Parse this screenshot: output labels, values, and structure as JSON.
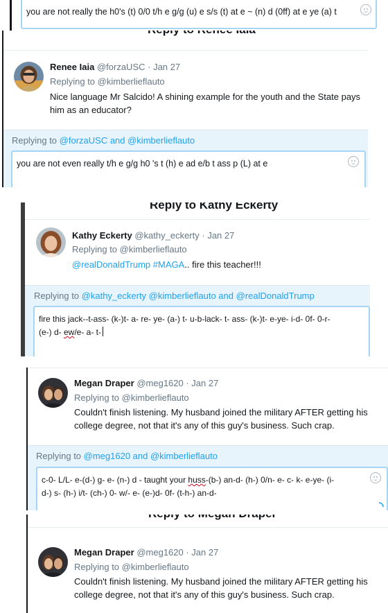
{
  "top_fragment": {
    "reply_text": "you are not really the h0's (t) 0/0 t/h e g/g (u) e s/s (t) at e ~ (n) d (0ff) at e ye (a) t",
    "emoji_icon": "smiley-icon"
  },
  "renee": {
    "heading": "Reply to Renee Iaia",
    "name": "Renee Iaia",
    "handle": "@forzaUSC",
    "date": "· Jan 27",
    "replying_to": "Replying to @kimberlieflauto",
    "body": "Nice language Mr Salcido! A shining example for the youth and the State pays him as an educator?",
    "reply_label_prefix": "Replying to ",
    "reply_label_links": "@forzaUSC and @kimberlieflauto",
    "reply_text": "you are not even really t/h e g/g h0 's t (h) e ad e/b t ass p (L) at e"
  },
  "kathy": {
    "heading": "Reply to Kathy Eckerty",
    "name": "Kathy Eckerty",
    "handle": "@kathy_eckerty",
    "date": "· Jan 27",
    "replying_to": "Replying to @kimberlieflauto",
    "body_links": "@realDonaldTrump  #MAGA",
    "body_text": ".. fire this teacher!!!",
    "reply_label_prefix": "Replying to ",
    "reply_label_links": "@kathy_eckerty @kimberlieflauto and @realDonaldTrump",
    "reply_line1": "fire this jack--t-ass- (k-)t- a- re- ye- (a-) t- u-b-lack- t- ass- (k-)t- e-ye- i-d- 0f- 0-r-",
    "reply_line2_a": "(e-) d- ",
    "reply_line2_spell": "ew",
    "reply_line2_b": "/e- a- t-"
  },
  "megan1": {
    "name": "Megan Draper",
    "handle": "@meg1620",
    "date": "· Jan 27",
    "replying_to": "Replying to @kimberlieflauto",
    "body": "Couldn't finish listening. My husband joined the military AFTER getting his college degree, not that it's any of this guy's business. Such crap.",
    "reply_label_prefix": "Replying to ",
    "reply_label_links": "@meg1620 and @kimberlieflauto",
    "reply_line1_a": "c-0- L/L- e-(d-) g- e- (n-) d -  taught your ",
    "reply_line1_spell": "huss",
    "reply_line1_b": "-(b-) an-d- (h-) 0/n- e- c- k- e-ye- (i-",
    "reply_line2": "d-) s- (h-) i/t- (ch-) 0- w/- e- (e-)d- 0f- (t-h-) an-d-"
  },
  "megan2": {
    "heading": "Reply to Megan Draper",
    "name": "Megan Draper",
    "handle": "@meg1620",
    "date": "· Jan 27",
    "replying_to": "Replying to @kimberlieflauto",
    "body": "Couldn't finish listening. My husband joined the military AFTER getting his college degree, not that it's any of this guy's business. Such crap."
  }
}
